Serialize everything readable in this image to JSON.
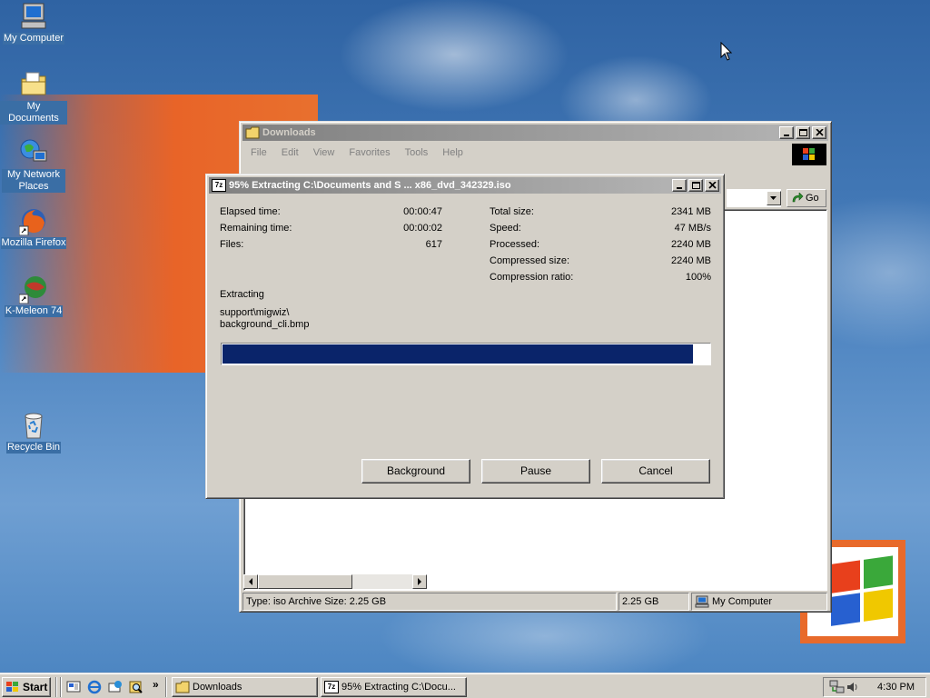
{
  "desktop": {
    "icons": [
      {
        "label": "My Computer"
      },
      {
        "label": "My Documents"
      },
      {
        "label": "My Network Places"
      },
      {
        "label": "Mozilla Firefox"
      },
      {
        "label": "K-Meleon 74"
      },
      {
        "label": "Recycle Bin"
      }
    ]
  },
  "explorer": {
    "title": "Downloads",
    "menu": [
      "File",
      "Edit",
      "View",
      "Favorites",
      "Tools",
      "Help"
    ],
    "go_label": "Go",
    "status": {
      "left": "Type: iso Archive Size: 2.25 GB",
      "size": "2.25 GB",
      "zone": "My Computer"
    }
  },
  "extract_dialog": {
    "title": "95% Extracting C:\\Documents and S ... x86_dvd_342329.iso",
    "title_icon": "7z",
    "elapsed_label": "Elapsed time:",
    "elapsed_value": "00:00:47",
    "remaining_label": "Remaining time:",
    "remaining_value": "00:00:02",
    "files_label": "Files:",
    "files_value": "617",
    "total_label": "Total size:",
    "total_value": "2341 MB",
    "speed_label": "Speed:",
    "speed_value": "47 MB/s",
    "processed_label": "Processed:",
    "processed_value": "2240 MB",
    "compressed_label": "Compressed size:",
    "compressed_value": "2240 MB",
    "ratio_label": "Compression ratio:",
    "ratio_value": "100%",
    "operation": "Extracting",
    "current_path": "support\\migwiz\\",
    "current_file": "background_cli.bmp",
    "progress_fraction": 0.967,
    "buttons": {
      "background": "Background",
      "pause": "Pause",
      "cancel": "Cancel"
    }
  },
  "taskbar": {
    "start_label": "Start",
    "tasks": [
      {
        "label": "Downloads"
      },
      {
        "label": "95% Extracting C:\\Docu..."
      }
    ],
    "quick_launch_more": "»",
    "clock": "4:30 PM"
  },
  "colors": {
    "desktop": "#3a6ea5",
    "progress_fill": "#0a246a",
    "face": "#d4d0c8"
  }
}
